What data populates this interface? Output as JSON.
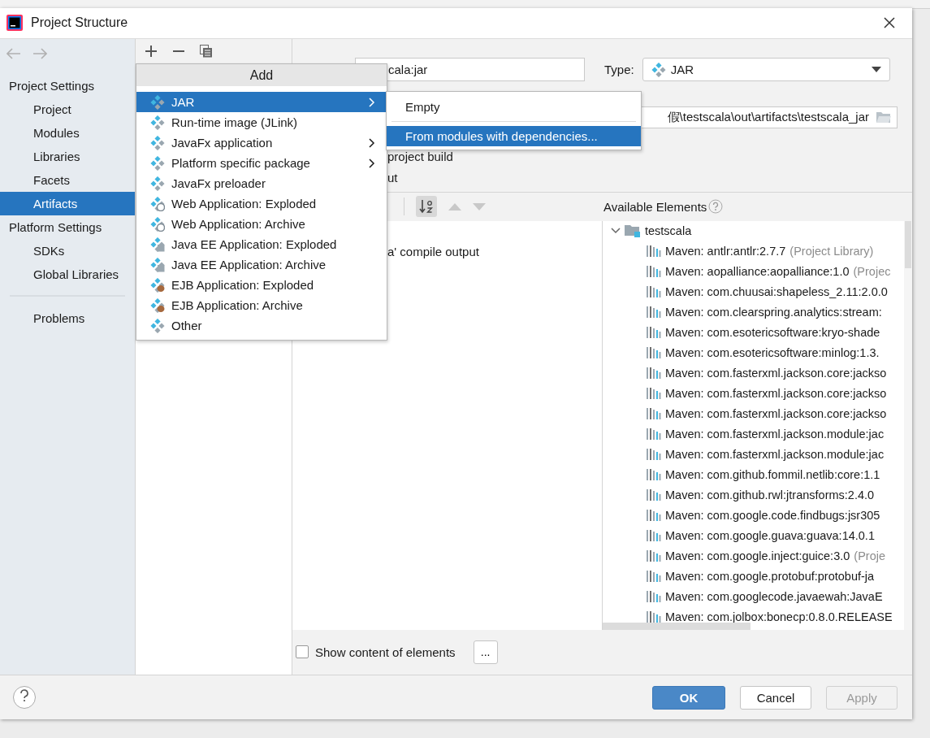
{
  "window": {
    "title": "Project Structure"
  },
  "sidebar": {
    "sections": [
      {
        "title": "Project Settings",
        "items": [
          {
            "label": "Project",
            "selected": false
          },
          {
            "label": "Modules",
            "selected": false
          },
          {
            "label": "Libraries",
            "selected": false
          },
          {
            "label": "Facets",
            "selected": false
          },
          {
            "label": "Artifacts",
            "selected": true
          }
        ]
      },
      {
        "title": "Platform Settings",
        "items": [
          {
            "label": "SDKs",
            "selected": false
          },
          {
            "label": "Global Libraries",
            "selected": false
          }
        ]
      }
    ],
    "extra_items": [
      {
        "label": "Problems",
        "selected": false
      }
    ]
  },
  "add_menu": {
    "title": "Add",
    "items": [
      {
        "label": "JAR",
        "kind": "plain",
        "submenu": true,
        "selected": true
      },
      {
        "label": "Run-time image (JLink)",
        "kind": "plain",
        "submenu": false,
        "selected": false
      },
      {
        "label": "JavaFx application",
        "kind": "plain",
        "submenu": true,
        "selected": false
      },
      {
        "label": "Platform specific package",
        "kind": "plain",
        "submenu": true,
        "selected": false
      },
      {
        "label": "JavaFx preloader",
        "kind": "plain",
        "submenu": false,
        "selected": false
      },
      {
        "label": "Web Application: Exploded",
        "kind": "web",
        "submenu": false,
        "selected": false
      },
      {
        "label": "Web Application: Archive",
        "kind": "web",
        "submenu": false,
        "selected": false
      },
      {
        "label": "Java EE Application: Exploded",
        "kind": "ee",
        "submenu": false,
        "selected": false
      },
      {
        "label": "Java EE Application: Archive",
        "kind": "ee",
        "submenu": false,
        "selected": false
      },
      {
        "label": "EJB Application: Exploded",
        "kind": "ejb",
        "submenu": false,
        "selected": false
      },
      {
        "label": "EJB Application: Archive",
        "kind": "ejb",
        "submenu": false,
        "selected": false
      },
      {
        "label": "Other",
        "kind": "plain",
        "submenu": false,
        "selected": false
      }
    ]
  },
  "jar_submenu": {
    "items": [
      {
        "label": "Empty",
        "selected": false
      },
      {
        "label": "From modules with dependencies...",
        "selected": true
      }
    ]
  },
  "artifact": {
    "name_value": "cala:jar",
    "type_label": "Type:",
    "type_value": "JAR",
    "output_path": "假\\testscala\\out\\artifacts\\testscala_jar",
    "include_label": "project build",
    "tab_label": "ut",
    "output_tree": [
      "a' compile output"
    ],
    "available_label": "Available Elements",
    "available_tree": {
      "label": "testscala",
      "expanded": true,
      "children": [
        {
          "label": "Maven: antlr:antlr:2.7.7",
          "note": "(Project Library)"
        },
        {
          "label": "Maven: aopalliance:aopalliance:1.0",
          "note": "(Projec"
        },
        {
          "label": "Maven: com.chuusai:shapeless_2.11:2.0.0"
        },
        {
          "label": "Maven: com.clearspring.analytics:stream:"
        },
        {
          "label": "Maven: com.esotericsoftware:kryo-shade"
        },
        {
          "label": "Maven: com.esotericsoftware:minlog:1.3."
        },
        {
          "label": "Maven: com.fasterxml.jackson.core:jackso"
        },
        {
          "label": "Maven: com.fasterxml.jackson.core:jackso"
        },
        {
          "label": "Maven: com.fasterxml.jackson.core:jackso"
        },
        {
          "label": "Maven: com.fasterxml.jackson.module:jac"
        },
        {
          "label": "Maven: com.fasterxml.jackson.module:jac"
        },
        {
          "label": "Maven: com.github.fommil.netlib:core:1.1"
        },
        {
          "label": "Maven: com.github.rwl:jtransforms:2.4.0"
        },
        {
          "label": "Maven: com.google.code.findbugs:jsr305"
        },
        {
          "label": "Maven: com.google.guava:guava:14.0.1"
        },
        {
          "label": "Maven: com.google.inject:guice:3.0",
          "note": "(Proje"
        },
        {
          "label": "Maven: com.google.protobuf:protobuf-ja"
        },
        {
          "label": "Maven: com.googlecode.javaewah:JavaE"
        },
        {
          "label": "Maven: com.jolbox:bonecp:0.8.0.RELEASE"
        }
      ]
    },
    "show_content": {
      "label": "Show content of elements",
      "checked": false
    },
    "more_button": "..."
  },
  "footer": {
    "buttons": [
      {
        "label": "OK",
        "kind": "primary",
        "disabled": false
      },
      {
        "label": "Cancel",
        "kind": "normal",
        "disabled": false
      },
      {
        "label": "Apply",
        "kind": "normal",
        "disabled": true
      }
    ]
  }
}
